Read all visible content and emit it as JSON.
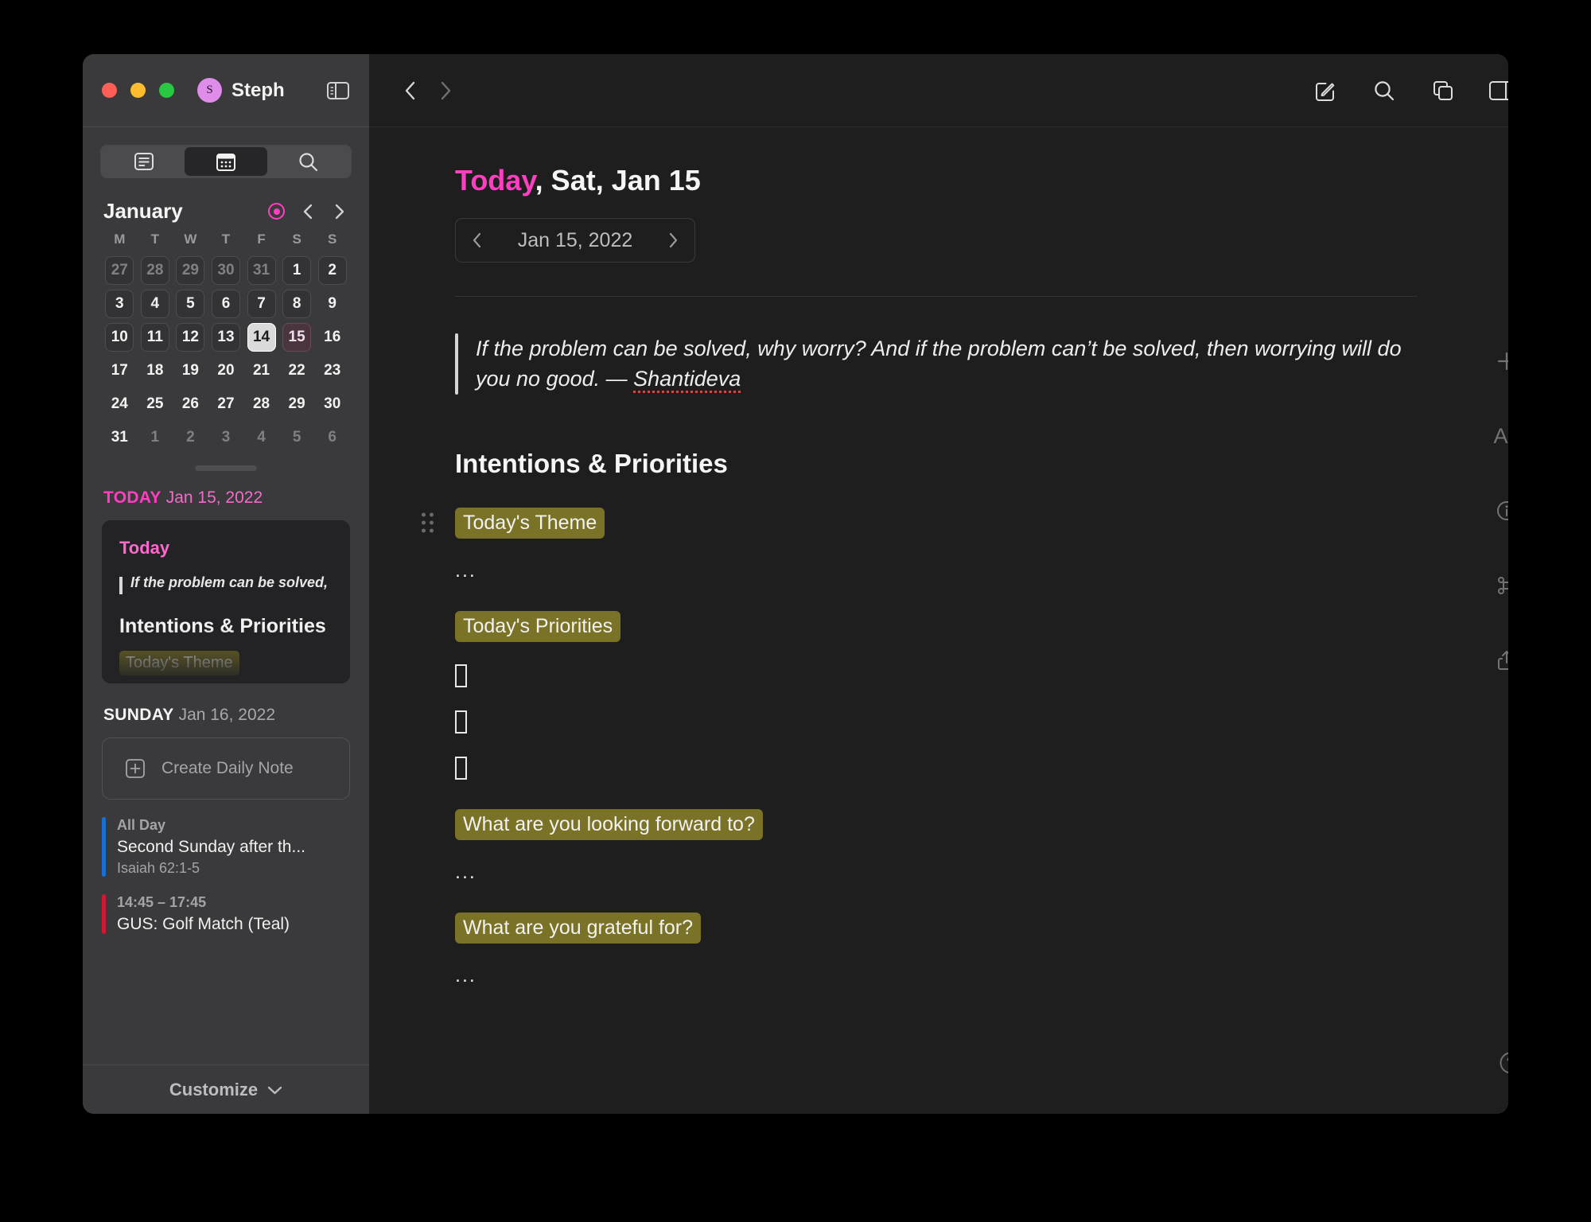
{
  "window": {
    "traffic_lights": [
      "close",
      "minimize",
      "zoom"
    ],
    "user_initial": "S",
    "user_name": "Steph"
  },
  "sidebar": {
    "segmented": [
      {
        "id": "notes-view",
        "icon": "note-list-icon",
        "active": false
      },
      {
        "id": "calendar-view",
        "icon": "calendar-icon",
        "active": true
      },
      {
        "id": "search-view",
        "icon": "search-icon",
        "active": false
      }
    ],
    "month": "January",
    "nav": {
      "today_icon": "today-dot-icon",
      "prev_icon": "chevron-left-icon",
      "next_icon": "chevron-right-icon"
    },
    "weekday_initials": [
      "M",
      "T",
      "W",
      "T",
      "F",
      "S",
      "S"
    ],
    "weeks": [
      [
        {
          "n": "27",
          "state": "out-box"
        },
        {
          "n": "28",
          "state": "out-box"
        },
        {
          "n": "29",
          "state": "out-box"
        },
        {
          "n": "30",
          "state": "out-box"
        },
        {
          "n": "31",
          "state": "out-box"
        },
        {
          "n": "1",
          "state": "box"
        },
        {
          "n": "2",
          "state": "box"
        }
      ],
      [
        {
          "n": "3",
          "state": "box"
        },
        {
          "n": "4",
          "state": "box"
        },
        {
          "n": "5",
          "state": "box"
        },
        {
          "n": "6",
          "state": "box"
        },
        {
          "n": "7",
          "state": "box"
        },
        {
          "n": "8",
          "state": "box"
        },
        {
          "n": "9",
          "state": "plain"
        }
      ],
      [
        {
          "n": "10",
          "state": "box"
        },
        {
          "n": "11",
          "state": "box"
        },
        {
          "n": "12",
          "state": "box"
        },
        {
          "n": "13",
          "state": "box"
        },
        {
          "n": "14",
          "state": "today"
        },
        {
          "n": "15",
          "state": "selected"
        },
        {
          "n": "16",
          "state": "plain"
        }
      ],
      [
        {
          "n": "17",
          "state": "plain"
        },
        {
          "n": "18",
          "state": "plain"
        },
        {
          "n": "19",
          "state": "plain"
        },
        {
          "n": "20",
          "state": "plain"
        },
        {
          "n": "21",
          "state": "plain"
        },
        {
          "n": "22",
          "state": "plain"
        },
        {
          "n": "23",
          "state": "plain"
        }
      ],
      [
        {
          "n": "24",
          "state": "plain"
        },
        {
          "n": "25",
          "state": "plain"
        },
        {
          "n": "26",
          "state": "plain"
        },
        {
          "n": "27",
          "state": "plain"
        },
        {
          "n": "28",
          "state": "plain"
        },
        {
          "n": "29",
          "state": "plain"
        },
        {
          "n": "30",
          "state": "plain"
        }
      ],
      [
        {
          "n": "31",
          "state": "plain"
        },
        {
          "n": "1",
          "state": "out"
        },
        {
          "n": "2",
          "state": "out"
        },
        {
          "n": "3",
          "state": "out"
        },
        {
          "n": "4",
          "state": "out"
        },
        {
          "n": "5",
          "state": "out"
        },
        {
          "n": "6",
          "state": "out"
        }
      ]
    ],
    "today_section": {
      "label": "TODAY",
      "date": "Jan 15, 2022",
      "note_preview": {
        "title": "Today",
        "quote": "If the problem can be solved,",
        "heading": "Intentions & Priorities",
        "highlight": "Today's Theme"
      }
    },
    "sunday_section": {
      "label": "SUNDAY",
      "date": "Jan 16, 2022",
      "create_note_label": "Create Daily Note",
      "create_note_icon": "plus-square-icon",
      "events": [
        {
          "time": "All Day",
          "title": "Second Sunday after th...",
          "subtitle": "Isaiah 62:1-5",
          "color": "#1a6fd4"
        },
        {
          "time": "14:45 – 17:45",
          "title": "GUS: Golf Match (Teal)",
          "subtitle": "",
          "color": "#d01933"
        }
      ]
    },
    "customize_label": "Customize",
    "customize_icon": "chevron-down-icon"
  },
  "main": {
    "toolbar": {
      "back_icon": "chevron-left-icon",
      "forward_icon": "chevron-right-icon",
      "compose_icon": "compose-icon",
      "search_icon": "search-icon",
      "duplicate_icon": "layers-icon",
      "right_sidebar_icon": "right-sidebar-toggle-icon"
    },
    "title_today": "Today",
    "title_rest": ", Sat, Jan 15",
    "date_stepper": {
      "prev_icon": "chevron-left-icon",
      "value": "Jan 15, 2022",
      "next_icon": "chevron-right-icon"
    },
    "quote": {
      "text_before": "If the problem can be solved, why worry? And if the problem can’t be solved, then worrying will do you no good. — ",
      "author": "Shantideva"
    },
    "section_title": "Intentions & Priorities",
    "blocks": [
      {
        "type": "highlight",
        "label": "Today's Theme",
        "has_drag_handle": true
      },
      {
        "type": "ellipsis",
        "label": "..."
      },
      {
        "type": "highlight",
        "label": "Today's Priorities",
        "has_drag_handle": false
      },
      {
        "type": "tofu"
      },
      {
        "type": "tofu"
      },
      {
        "type": "tofu"
      },
      {
        "type": "highlight",
        "label": "What are you looking forward to?",
        "has_drag_handle": false
      },
      {
        "type": "ellipsis",
        "label": "..."
      },
      {
        "type": "highlight",
        "label": "What are you grateful for?",
        "has_drag_handle": false
      },
      {
        "type": "ellipsis",
        "label": "..."
      }
    ],
    "right_rail": [
      {
        "id": "add",
        "icon": "plus-icon"
      },
      {
        "id": "text-format",
        "icon": "aa-text-icon",
        "label": "Aa"
      },
      {
        "id": "info",
        "icon": "info-circle-icon"
      },
      {
        "id": "shortcuts",
        "icon": "command-icon"
      },
      {
        "id": "share",
        "icon": "share-icon"
      }
    ],
    "help_icon": "help-circle-icon"
  },
  "colors": {
    "accent_pink": "#ff3fc0",
    "highlight_olive": "#7a7227",
    "event_blue": "#1a6fd4",
    "event_red": "#d01933",
    "sidebar_bg": "#3a3a3c",
    "main_bg": "#1e1e1e"
  }
}
